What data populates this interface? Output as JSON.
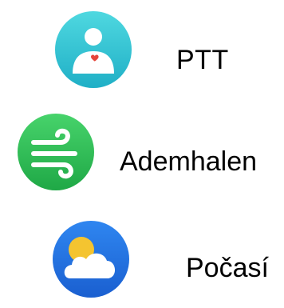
{
  "apps": [
    {
      "label": "PTT",
      "icon": "ptt-body-heart-icon",
      "color": "#25C4D4"
    },
    {
      "label": "Ademhalen",
      "icon": "breathe-wind-icon",
      "color": "#2DBE4F"
    },
    {
      "label": "Počasí",
      "icon": "weather-sun-cloud-icon",
      "color": "#1E6FE0"
    }
  ]
}
